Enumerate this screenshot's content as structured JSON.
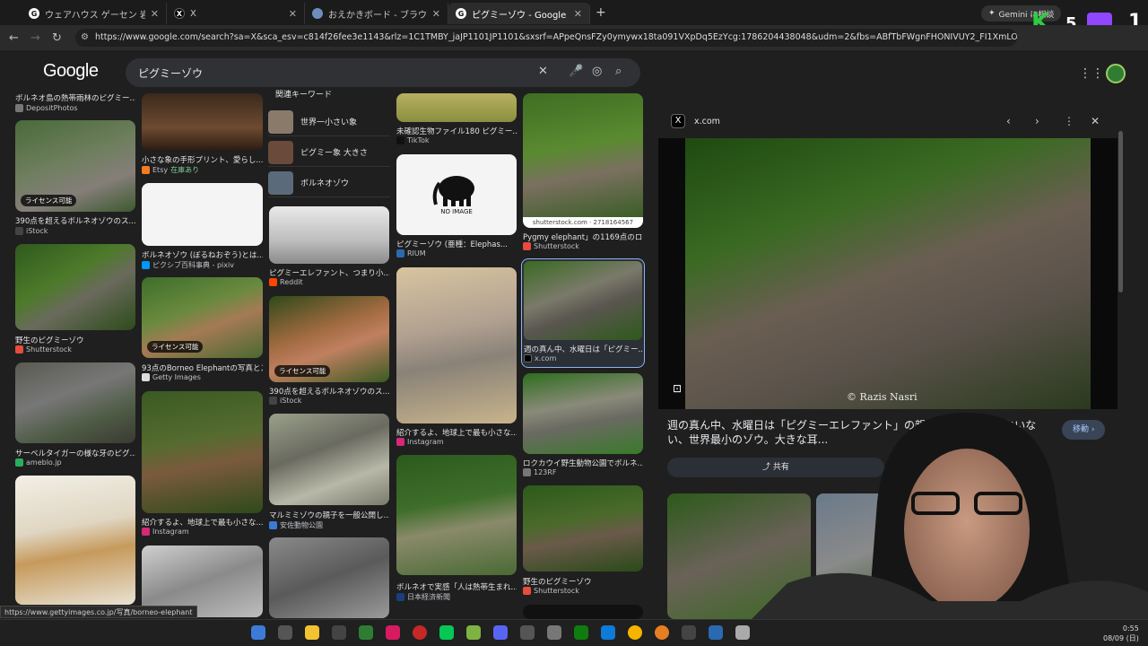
{
  "tabs": [
    {
      "title": "ウェアハウス ゲーセン 岩 - Google",
      "favicon": "G"
    },
    {
      "title": "X",
      "favicon": "X"
    },
    {
      "title": "おえかきボード - ブラウザでかんたん",
      "favicon": "🌐"
    },
    {
      "title": "ピグミーゾウ - Google 検索",
      "favicon": "G"
    }
  ],
  "gemini_label": "Gemini に相談",
  "url": "https://www.google.com/search?sa=X&sca_esv=c814f26fee3e1143&rlz=1C1TMBY_jaJP1101JP1101&sxsrf=APpeQnsFZy0ymywx18ta091VXpDq5EzYcg:1786204438048&udm=2&fbs=ABfTbFWgnFHONIVUY2_FI1XmLOwBp89Elpcfet_ZSVppJkijaywh4Vz...",
  "search": {
    "query": "ピグミーゾウ"
  },
  "overlay": {
    "k": "K",
    "num5": "5",
    "one": "1"
  },
  "col1": [
    {
      "cap": "ボルネオ島の熱帯雨林のピグミー...",
      "src": "DepositPhotos"
    },
    {
      "cap": "390点を超えるボルネオゾウのス...",
      "src": "iStock",
      "license": "ライセンス可能"
    },
    {
      "cap": "野生のピグミーゾウ",
      "src": "Shutterstock"
    },
    {
      "cap": "サーベルタイガーの様な牙のピグ...",
      "src": "ameblo.jp"
    }
  ],
  "col2": [
    {
      "cap": "小さな象の手形プリント、愛らし...",
      "src": "Etsy",
      "stock": "在庫あり"
    },
    {
      "cap": "ボルネオゾウ (ぼるねおぞう)とは...",
      "src": "ピクシブ百科事典 - pixiv"
    },
    {
      "cap": "93点のBorneo Elephantの写真とス...",
      "src": "Getty Images",
      "license": "ライセンス可能"
    },
    {
      "cap": "紹介するよ、地球上で最も小さな...",
      "src": "Instagram"
    }
  ],
  "related": {
    "title": "関連キーワード",
    "items": [
      "世界一小さい象",
      "ピグミー象 大きさ",
      "ボルネオゾウ"
    ]
  },
  "col3": [
    {
      "cap": "ピグミーエレファント、つまり小...",
      "src": "Reddit"
    },
    {
      "cap": "390点を超えるボルネオゾウのス...",
      "src": "iStock",
      "license": "ライセンス可能"
    },
    {
      "cap": "マルミミゾウの親子を一般公開し...",
      "src": "安佐動物公園"
    }
  ],
  "col4": [
    {
      "cap": "未確認生物ファイル180 ピグミー...",
      "src": "TikTok"
    },
    {
      "cap": "ピグミーゾウ (亜種：Elephas...",
      "src": "RIUM",
      "noimage": "NO IMAGE"
    },
    {
      "cap": "紹介するよ、地球上で最も小さな...",
      "src": "Instagram"
    },
    {
      "cap": "ボルネオで実感「人は熱帯生まれ...",
      "src": "日本経済新聞"
    }
  ],
  "col5": [
    {
      "cap": "Pygmy elephant」の1169点のロイ...",
      "src": "Shutterstock",
      "wm": "shutterstock.com · 2718164567"
    },
    {
      "cap": "週の真ん中、水曜日は「ピグミー...",
      "src": "x.com"
    },
    {
      "cap": "ロクカウイ野生動物公園でボルネ...",
      "src": "123RF"
    },
    {
      "cap": "野生のピグミーゾウ",
      "src": "Shutterstock"
    }
  ],
  "panel": {
    "site": "x.com",
    "title": "週の真ん中、水曜日は「ピグミーエレファント」の親... ルネオ島にしかいない、世界最小のゾウ。大きな耳...",
    "credit": "© Razis Nasri",
    "goto": "移動",
    "share": "共有"
  },
  "status_url": "https://www.gettyimages.co.jp/写真/borneo-elephant",
  "clock": {
    "time": "0:55",
    "date": "08/09 (日)"
  },
  "colors": {
    "accent": "#a8c7fa",
    "bg": "#1f1f1f"
  }
}
